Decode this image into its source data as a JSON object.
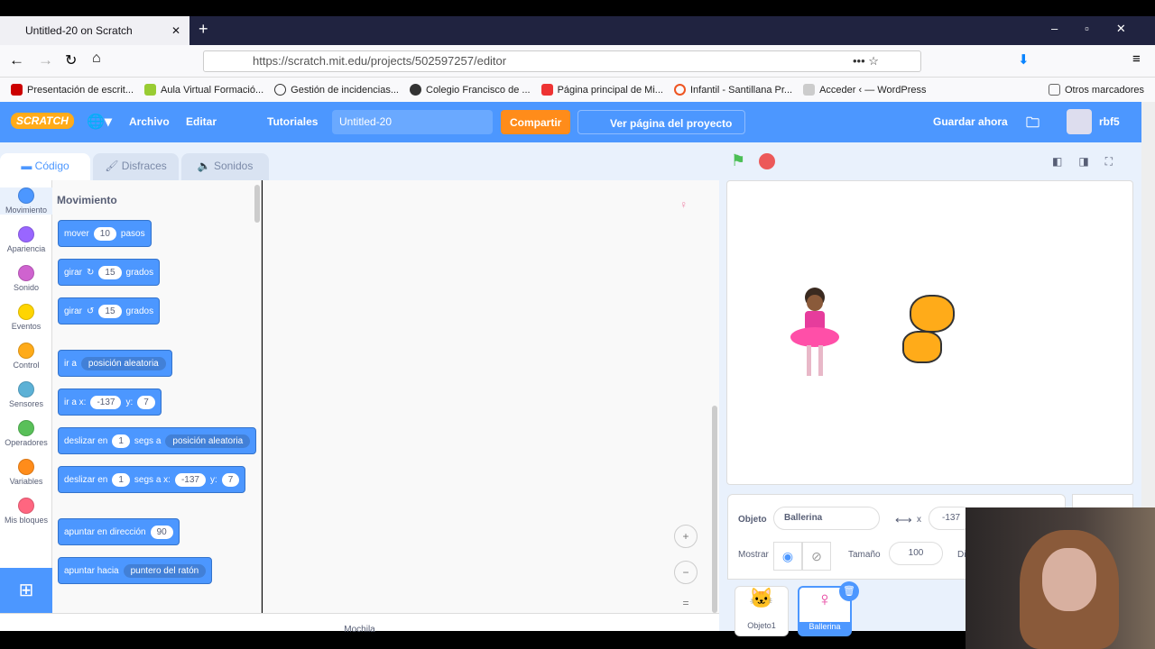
{
  "browser": {
    "tab_title": "Untitled-20 on Scratch",
    "url": "https://scratch.mit.edu/projects/502597257/editor",
    "bookmarks": [
      "Presentación de escrit...",
      "Aula Virtual Formació...",
      "Gestión de incidencias...",
      "Colegio Francisco de ...",
      "Página principal de Mi...",
      "Infantil - Santillana Pr...",
      "Acceder ‹ — WordPress"
    ],
    "other_bookmarks": "Otros marcadores"
  },
  "menu": {
    "logo": "SCRATCH",
    "archivo": "Archivo",
    "editar": "Editar",
    "tutoriales": "Tutoriales",
    "project_title": "Untitled-20",
    "share": "Compartir",
    "see_page": "Ver página del proyecto",
    "save_now": "Guardar ahora",
    "user": "rbf5"
  },
  "tabs": {
    "code": "Código",
    "costumes": "Disfraces",
    "sounds": "Sonidos"
  },
  "categories": [
    {
      "label": "Movimiento",
      "color": "#4c97ff"
    },
    {
      "label": "Apariencia",
      "color": "#9966ff"
    },
    {
      "label": "Sonido",
      "color": "#cf63cf"
    },
    {
      "label": "Eventos",
      "color": "#ffd500"
    },
    {
      "label": "Control",
      "color": "#ffab19"
    },
    {
      "label": "Sensores",
      "color": "#5cb1d6"
    },
    {
      "label": "Operadores",
      "color": "#59c059"
    },
    {
      "label": "Variables",
      "color": "#ff8c1a"
    },
    {
      "label": "Mis bloques",
      "color": "#ff6680"
    }
  ],
  "palette": {
    "heading": "Movimiento",
    "blocks": {
      "move": [
        "mover",
        "10",
        "pasos"
      ],
      "turn_right": [
        "girar",
        "15",
        "grados"
      ],
      "turn_left": [
        "girar",
        "15",
        "grados"
      ],
      "goto": [
        "ir a",
        "posición aleatoria"
      ],
      "goto_xy": [
        "ir a x:",
        "-137",
        "y:",
        "7"
      ],
      "glide_to": [
        "deslizar en",
        "1",
        "segs a",
        "posición aleatoria"
      ],
      "glide_xy": [
        "deslizar en",
        "1",
        "segs a x:",
        "-137",
        "y:",
        "7"
      ],
      "point_dir": [
        "apuntar en dirección",
        "90"
      ],
      "point_towards": [
        "apuntar hacia",
        "puntero del ratón"
      ]
    }
  },
  "bottom_label": "Mochila",
  "sprite_info": {
    "object_label": "Objeto",
    "name": "Ballerina",
    "x_label": "x",
    "x": "-137",
    "show_label": "Mostrar",
    "size_label": "Tamaño",
    "size": "100",
    "dir_label": "Di"
  },
  "sprites": [
    {
      "name": "Objeto1"
    },
    {
      "name": "Ballerina",
      "selected": true
    }
  ]
}
